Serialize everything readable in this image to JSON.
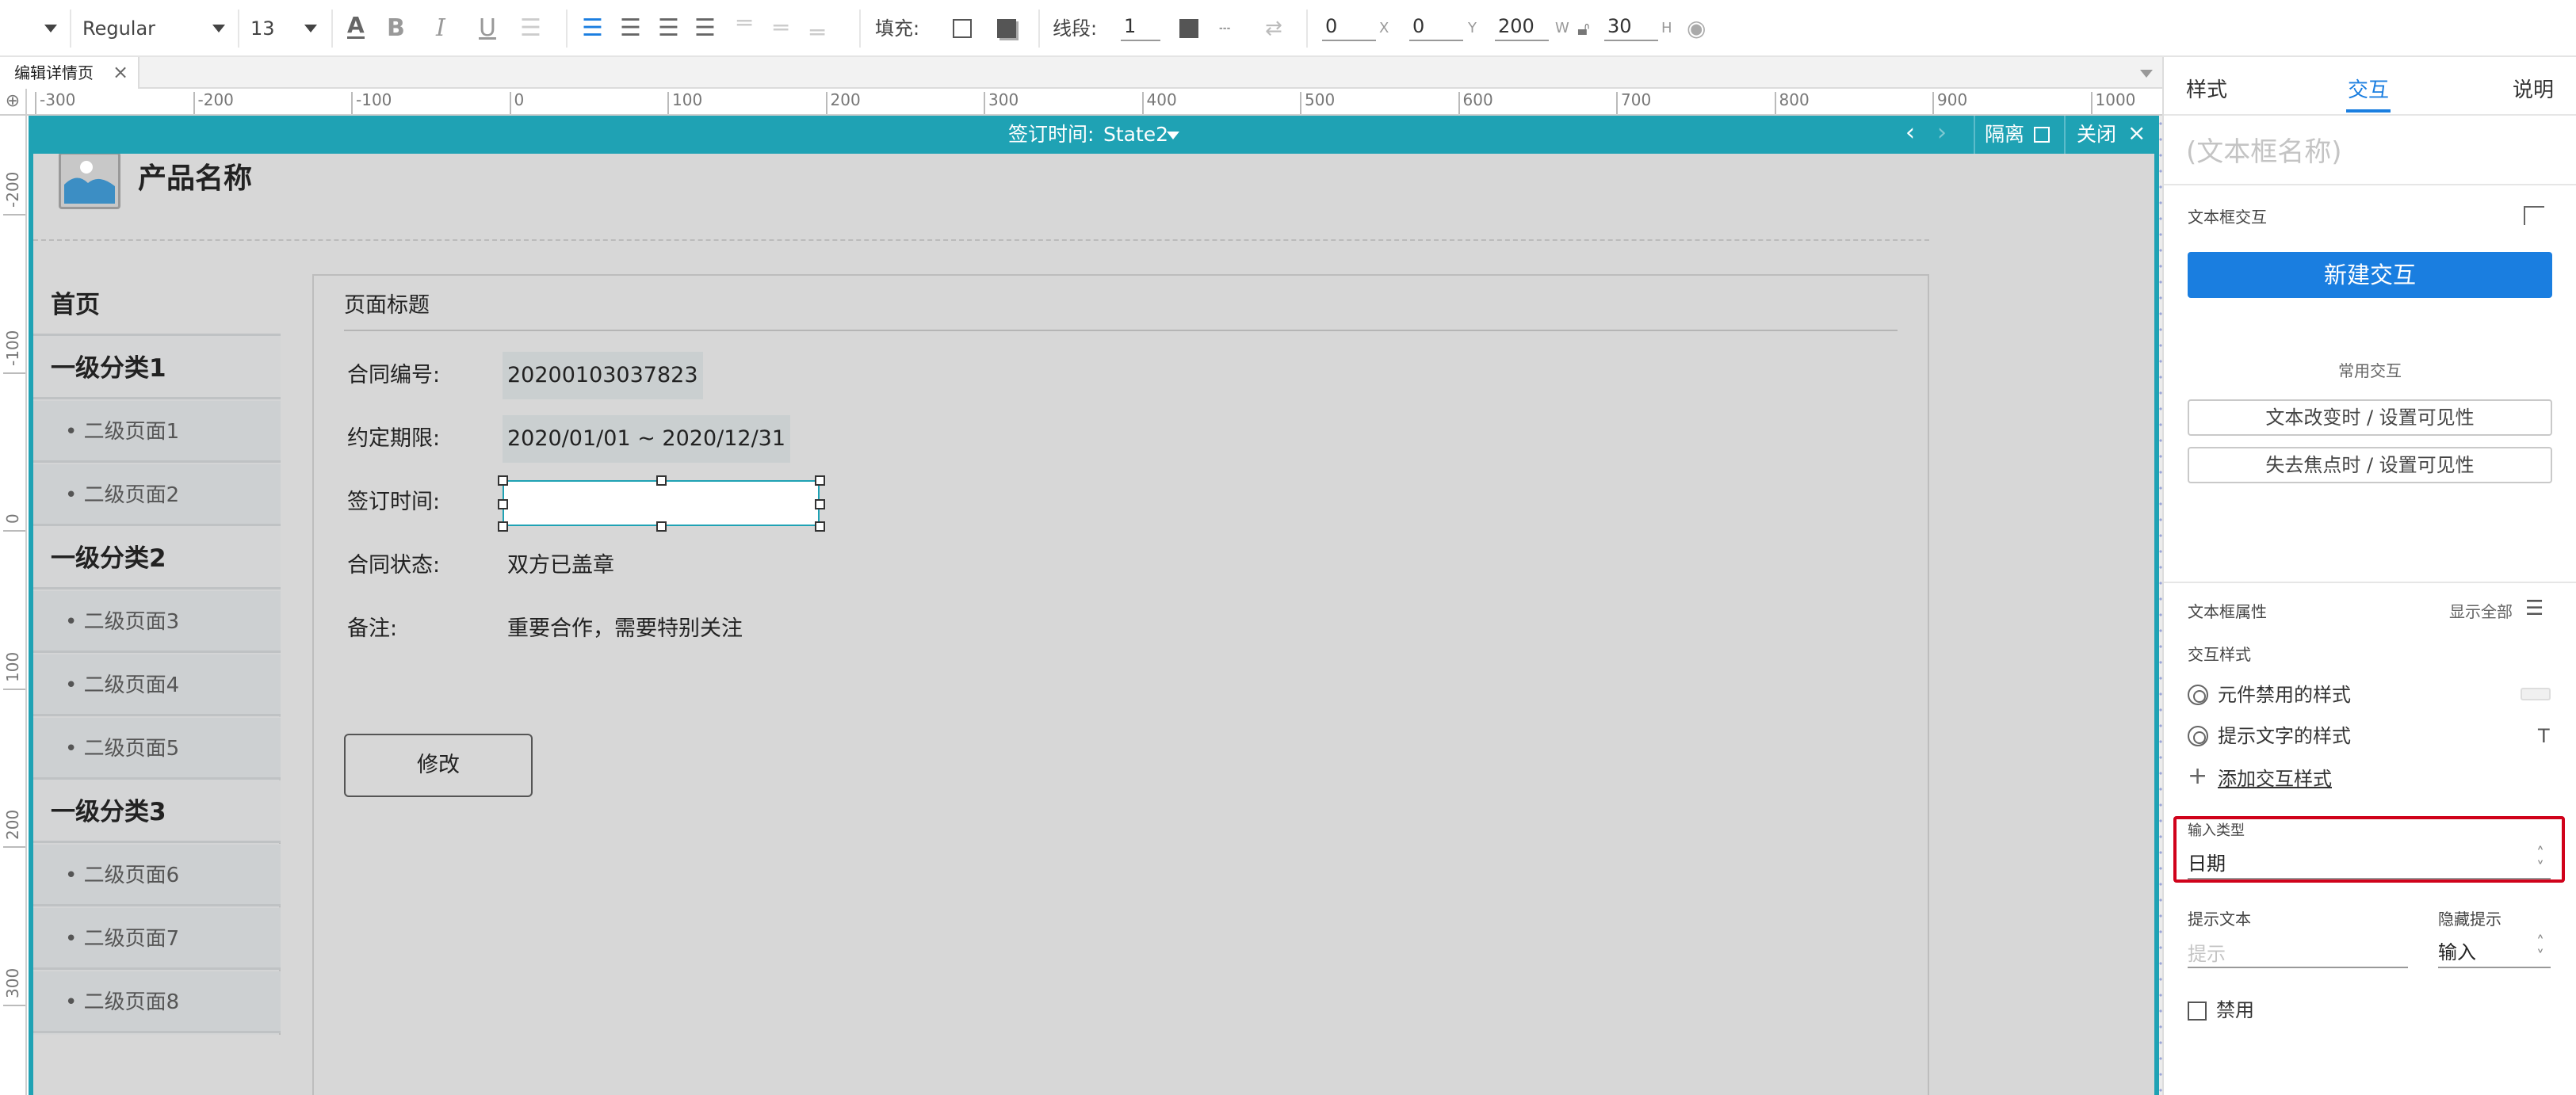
{
  "toolbar": {
    "font_style": "Regular",
    "font_size": "13",
    "fill_label": "填充:",
    "stroke_label": "线段:",
    "stroke_value": "1",
    "x_value": "0",
    "x_unit": "X",
    "y_value": "0",
    "y_unit": "Y",
    "w_value": "200",
    "w_unit": "W",
    "h_value": "30",
    "h_unit": "H"
  },
  "tab": {
    "title": "编辑详情页",
    "close": "×"
  },
  "ruler": {
    "h_labels": [
      "-300",
      "-200",
      "-100",
      "0",
      "100",
      "200",
      "300",
      "400",
      "500",
      "600",
      "700",
      "800",
      "900",
      "1000"
    ],
    "v_labels": [
      "-200",
      "-100",
      "0",
      "100",
      "200",
      "300"
    ]
  },
  "frame": {
    "state_label": "签订时间:",
    "state_value": "State2",
    "isolate": "隔离",
    "close": "关闭"
  },
  "product": {
    "name": "产品名称"
  },
  "nav": {
    "home": "首页",
    "cat1": "一级分类1",
    "p1": "• 二级页面1",
    "p2": "• 二级页面2",
    "cat2": "一级分类2",
    "p3": "• 二级页面3",
    "p4": "• 二级页面4",
    "p5": "• 二级页面5",
    "cat3": "一级分类3",
    "p6": "• 二级页面6",
    "p7": "• 二级页面7",
    "p8": "• 二级页面8"
  },
  "content": {
    "title": "页面标题",
    "f1_label": "合同编号:",
    "f1_value": "20200103037823",
    "f2_label": "约定期限:",
    "f2_value": "2020/01/01 ~ 2020/12/31",
    "f3_label": "签订时间:",
    "f4_label": "合同状态:",
    "f4_value": "双方已盖章",
    "f5_label": "备注:",
    "f5_value": "重要合作，需要特别关注",
    "edit_button": "修改"
  },
  "panel": {
    "tabs": [
      "样式",
      "交互",
      "说明"
    ],
    "name_placeholder": "(文本框名称)",
    "interaction_section": "文本框交互",
    "new_interaction": "新建交互",
    "common_label": "常用交互",
    "common1": "文本改变时 / 设置可见性",
    "common2": "失去焦点时 / 设置可见性",
    "props_label": "文本框属性",
    "show_all": "显示全部",
    "interaction_style": "交互样式",
    "disabled_style": "元件禁用的样式",
    "hint_style": "提示文字的样式",
    "add_style": "添加交互样式",
    "input_type_label": "输入类型",
    "input_type_value": "日期",
    "hint_text_label": "提示文本",
    "hint_text_placeholder": "提示",
    "hide_hint_label": "隐藏提示",
    "hide_hint_value": "输入",
    "disable_label": "禁用",
    "text_icon": "T"
  },
  "colors": {
    "accent": "#1fa2b4",
    "primary": "#1a7ee0",
    "highlight": "#d0021b"
  }
}
